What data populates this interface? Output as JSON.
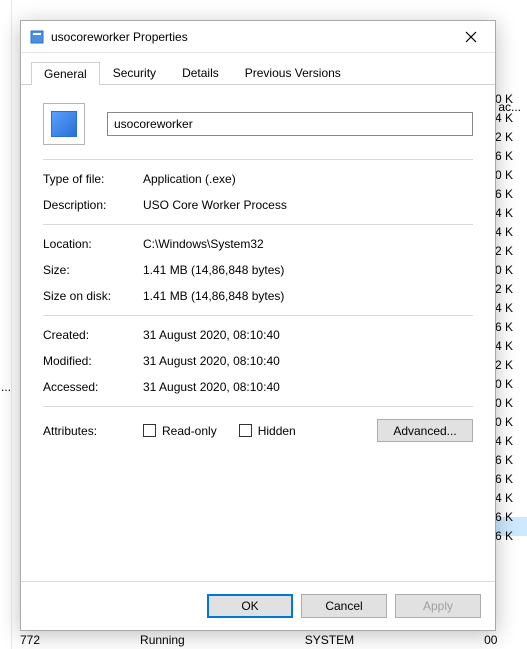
{
  "window": {
    "title": "usocoreworker Properties"
  },
  "tabs": {
    "t0": "General",
    "t1": "Security",
    "t2": "Details",
    "t3": "Previous Versions"
  },
  "general": {
    "name_value": "usocoreworker",
    "labels": {
      "type": "Type of file:",
      "desc": "Description:",
      "loc": "Location:",
      "size": "Size:",
      "sod": "Size on disk:",
      "created": "Created:",
      "modified": "Modified:",
      "accessed": "Accessed:",
      "attrs": "Attributes:",
      "readonly": "Read-only",
      "hidden": "Hidden",
      "advanced": "Advanced..."
    },
    "values": {
      "type": "Application (.exe)",
      "desc": "USO Core Worker Process",
      "loc": "C:\\Windows\\System32",
      "size": "1.41 MB (14,86,848 bytes)",
      "sod": "1.41 MB (14,86,848 bytes)",
      "created": "31 August 2020, 08:10:40",
      "modified": "31 August 2020, 08:10:40",
      "accessed": "31 August 2020, 08:10:40"
    }
  },
  "footer": {
    "ok": "OK",
    "cancel": "Cancel",
    "apply": "Apply"
  },
  "background": {
    "header_fragment": "ac...",
    "rows": [
      "0 K",
      "4 K",
      "2 K",
      "6 K",
      "0 K",
      "6 K",
      "4 K",
      "4 K",
      "2 K",
      "0 K",
      "2 K",
      "4 K",
      "6 K",
      "4 K",
      "2 K",
      "0 K",
      "0 K",
      "0 K",
      "4 K",
      "6 K",
      "6 K",
      "4 K",
      "6 K",
      "6 K"
    ],
    "bottom_pid": "772",
    "bottom_status": "Running",
    "bottom_user": "SYSTEM",
    "bottom_cpu": "00"
  }
}
